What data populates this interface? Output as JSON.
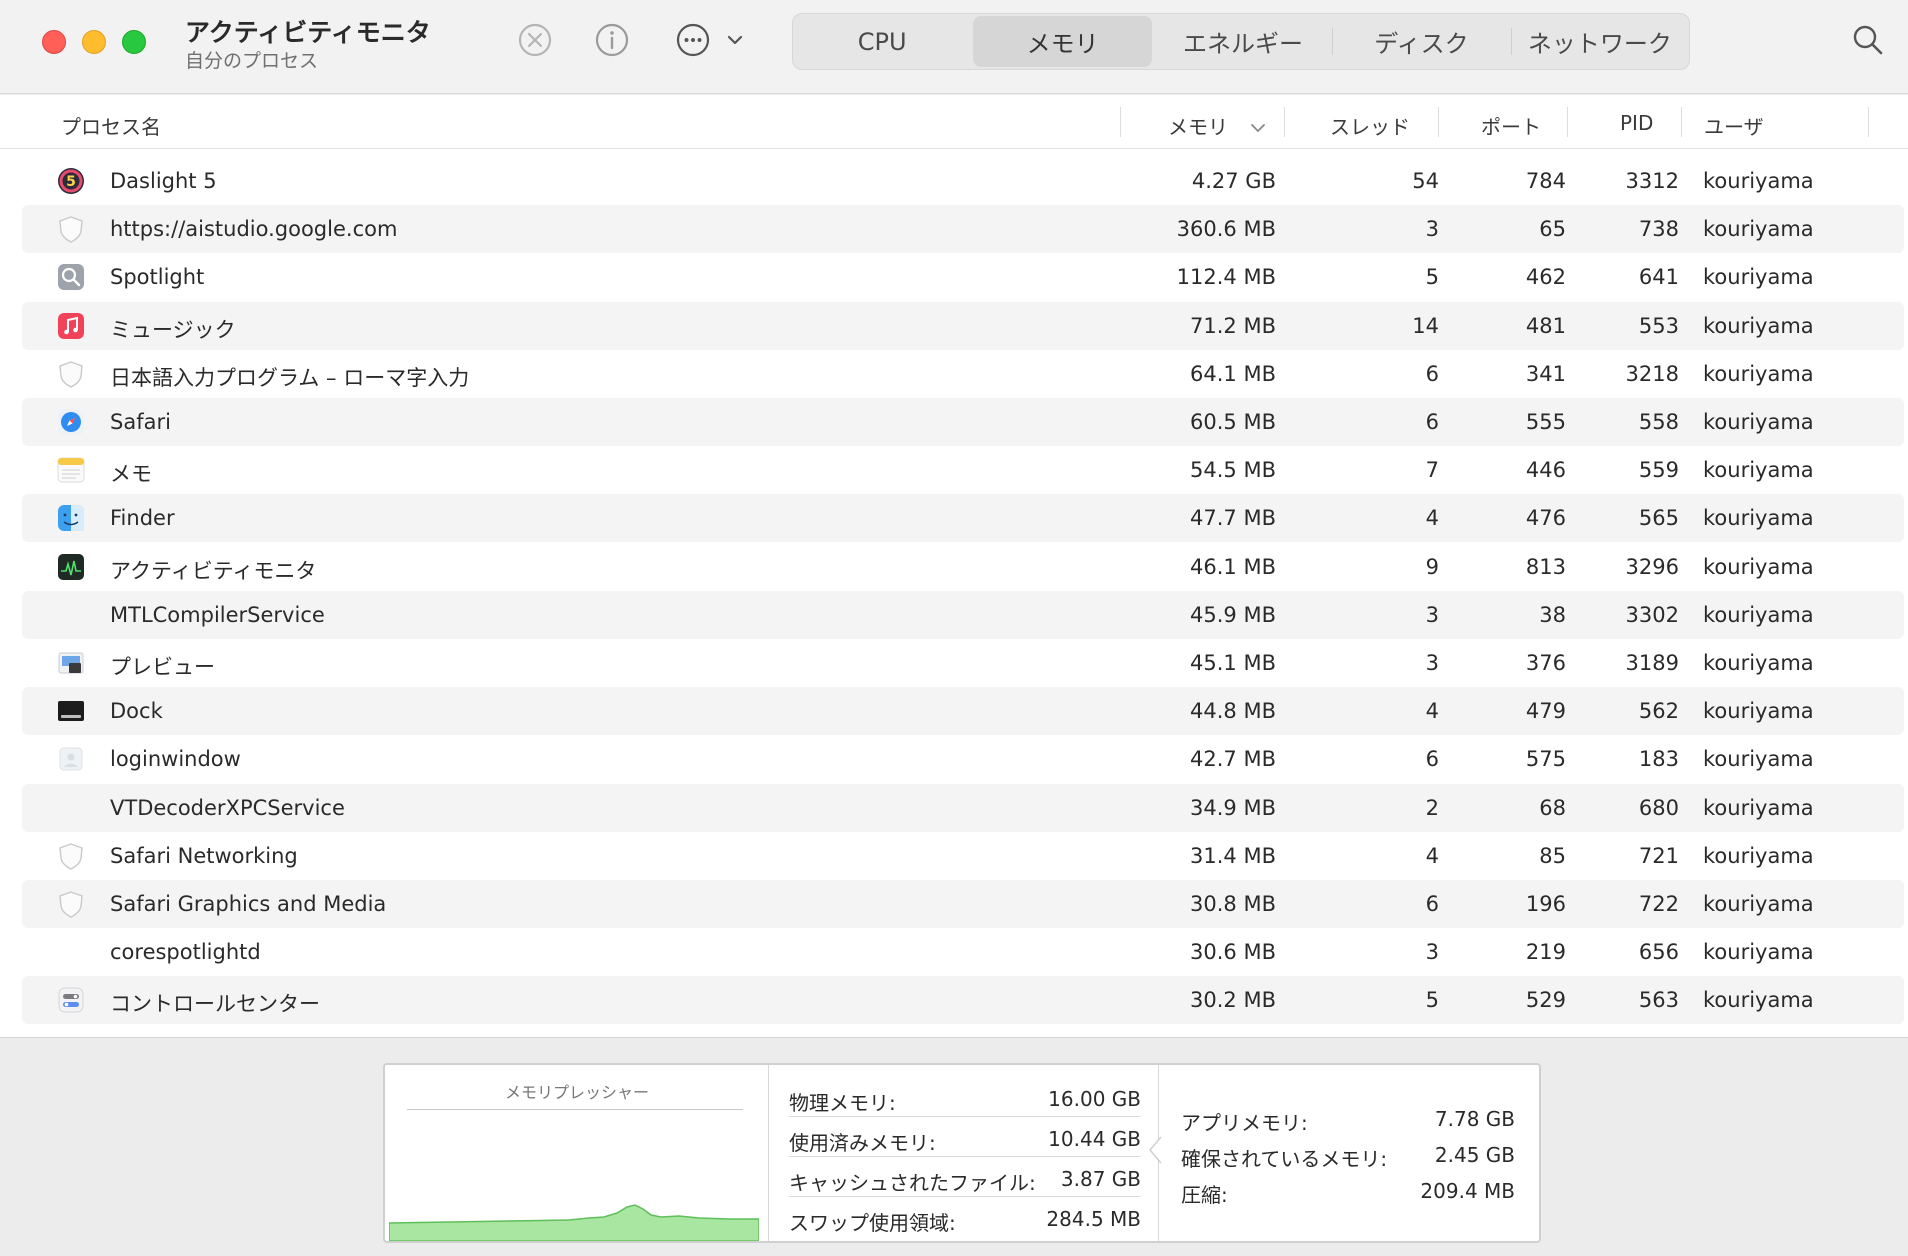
{
  "window": {
    "title": "アクティビティモニタ",
    "subtitle": "自分のプロセス"
  },
  "toolbar": {
    "icons": [
      "stop-process-icon",
      "info-icon",
      "more-actions-icon",
      "chevron-down-icon",
      "search-icon"
    ]
  },
  "tabs": [
    {
      "label": "CPU",
      "active": false
    },
    {
      "label": "メモリ",
      "active": true
    },
    {
      "label": "エネルギー",
      "active": false
    },
    {
      "label": "ディスク",
      "active": false
    },
    {
      "label": "ネットワーク",
      "active": false
    }
  ],
  "columns": {
    "name": "プロセス名",
    "memory": "メモリ",
    "threads": "スレッド",
    "ports": "ポート",
    "pid": "PID",
    "user": "ユーザ"
  },
  "processes": [
    {
      "icon": "daslight-icon",
      "name": "Daslight 5",
      "memory": "4.27 GB",
      "threads": "54",
      "ports": "784",
      "pid": "3312",
      "user": "kouriyama"
    },
    {
      "icon": "shield-icon",
      "name": "https://aistudio.google.com",
      "memory": "360.6 MB",
      "threads": "3",
      "ports": "65",
      "pid": "738",
      "user": "kouriyama"
    },
    {
      "icon": "spotlight-icon",
      "name": "Spotlight",
      "memory": "112.4 MB",
      "threads": "5",
      "ports": "462",
      "pid": "641",
      "user": "kouriyama"
    },
    {
      "icon": "music-icon",
      "name": "ミュージック",
      "memory": "71.2 MB",
      "threads": "14",
      "ports": "481",
      "pid": "553",
      "user": "kouriyama"
    },
    {
      "icon": "shield-icon",
      "name": "日本語入力プログラム – ローマ字入力",
      "memory": "64.1 MB",
      "threads": "6",
      "ports": "341",
      "pid": "3218",
      "user": "kouriyama"
    },
    {
      "icon": "safari-icon",
      "name": "Safari",
      "memory": "60.5 MB",
      "threads": "6",
      "ports": "555",
      "pid": "558",
      "user": "kouriyama"
    },
    {
      "icon": "notes-icon",
      "name": "メモ",
      "memory": "54.5 MB",
      "threads": "7",
      "ports": "446",
      "pid": "559",
      "user": "kouriyama"
    },
    {
      "icon": "finder-icon",
      "name": "Finder",
      "memory": "47.7 MB",
      "threads": "4",
      "ports": "476",
      "pid": "565",
      "user": "kouriyama"
    },
    {
      "icon": "activity-monitor-icon",
      "name": "アクティビティモニタ",
      "memory": "46.1 MB",
      "threads": "9",
      "ports": "813",
      "pid": "3296",
      "user": "kouriyama"
    },
    {
      "icon": "",
      "name": "MTLCompilerService",
      "memory": "45.9 MB",
      "threads": "3",
      "ports": "38",
      "pid": "3302",
      "user": "kouriyama"
    },
    {
      "icon": "preview-icon",
      "name": "プレビュー",
      "memory": "45.1 MB",
      "threads": "3",
      "ports": "376",
      "pid": "3189",
      "user": "kouriyama"
    },
    {
      "icon": "dock-icon",
      "name": "Dock",
      "memory": "44.8 MB",
      "threads": "4",
      "ports": "479",
      "pid": "562",
      "user": "kouriyama"
    },
    {
      "icon": "loginwindow-icon",
      "name": "loginwindow",
      "memory": "42.7 MB",
      "threads": "6",
      "ports": "575",
      "pid": "183",
      "user": "kouriyama"
    },
    {
      "icon": "",
      "name": "VTDecoderXPCService",
      "memory": "34.9 MB",
      "threads": "2",
      "ports": "68",
      "pid": "680",
      "user": "kouriyama"
    },
    {
      "icon": "shield-icon",
      "name": "Safari Networking",
      "memory": "31.4 MB",
      "threads": "4",
      "ports": "85",
      "pid": "721",
      "user": "kouriyama"
    },
    {
      "icon": "shield-icon",
      "name": "Safari Graphics and Media",
      "memory": "30.8 MB",
      "threads": "6",
      "ports": "196",
      "pid": "722",
      "user": "kouriyama"
    },
    {
      "icon": "",
      "name": "corespotlightd",
      "memory": "30.6 MB",
      "threads": "3",
      "ports": "219",
      "pid": "656",
      "user": "kouriyama"
    },
    {
      "icon": "control-center-icon",
      "name": "コントロールセンター",
      "memory": "30.2 MB",
      "threads": "5",
      "ports": "529",
      "pid": "563",
      "user": "kouriyama"
    }
  ],
  "summary": {
    "pressure_title": "メモリプレッシャー",
    "stats_left": [
      {
        "label": "物理メモリ:",
        "value": "16.00 GB"
      },
      {
        "label": "使用済みメモリ:",
        "value": "10.44 GB"
      },
      {
        "label": "キャッシュされたファイル:",
        "value": "3.87 GB"
      },
      {
        "label": "スワップ使用領域:",
        "value": "284.5 MB"
      }
    ],
    "stats_right": [
      {
        "label": "アプリメモリ:",
        "value": "7.78 GB"
      },
      {
        "label": "確保されているメモリ:",
        "value": "2.45 GB"
      },
      {
        "label": "圧縮:",
        "value": "209.4 MB"
      }
    ]
  },
  "colors": {
    "pressure_fill": "#a8e6a1",
    "pressure_stroke": "#5fbf5a",
    "accent_close": "#ff5f57",
    "accent_minimize": "#febc2e",
    "accent_zoom": "#28c840"
  }
}
